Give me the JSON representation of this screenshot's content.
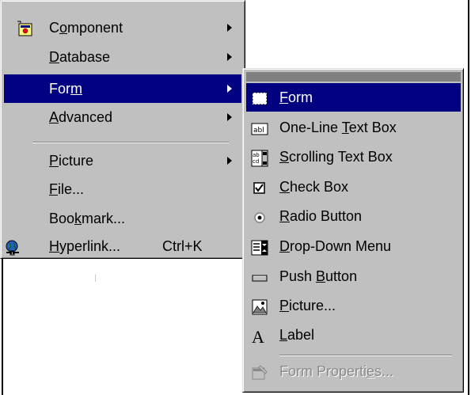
{
  "main_menu": {
    "items": [
      {
        "name": "component",
        "label": "Component",
        "mnemonic_index": 1,
        "has_submenu": true,
        "icon": "component-icon"
      },
      {
        "name": "database",
        "label": "Database",
        "mnemonic_index": 0,
        "has_submenu": true
      },
      {
        "name": "form",
        "label": "Form",
        "mnemonic_index": 3,
        "has_submenu": true,
        "highlighted": true
      },
      {
        "name": "advanced",
        "label": "Advanced",
        "mnemonic_index": 0,
        "has_submenu": true
      },
      {
        "name": "picture",
        "label": "Picture",
        "mnemonic_index": 0,
        "has_submenu": true
      },
      {
        "name": "file",
        "label": "File...",
        "mnemonic_index": 0
      },
      {
        "name": "bookmark",
        "label": "Bookmark...",
        "mnemonic_index": 3
      },
      {
        "name": "hyperlink",
        "label": "Hyperlink...",
        "mnemonic_index": 0,
        "shortcut": "Ctrl+K",
        "icon": "hyperlink-globe-icon"
      }
    ]
  },
  "form_submenu": {
    "items": [
      {
        "name": "form",
        "label": "Form",
        "mnemonic_index": 0,
        "icon": "form-dotted-box-icon",
        "highlighted": true
      },
      {
        "name": "one-line-text-box",
        "label": "One-Line Text Box",
        "mnemonic_index": 9,
        "icon": "text-box-icon"
      },
      {
        "name": "scrolling-text-box",
        "label": "Scrolling Text Box",
        "mnemonic_index": 0,
        "icon": "scrolling-text-box-icon"
      },
      {
        "name": "check-box",
        "label": "Check Box",
        "mnemonic_index": 0,
        "icon": "checkbox-icon"
      },
      {
        "name": "radio-button",
        "label": "Radio Button",
        "mnemonic_index": 0,
        "icon": "radio-button-icon"
      },
      {
        "name": "drop-down-menu",
        "label": "Drop-Down Menu",
        "mnemonic_index": 0,
        "icon": "drop-down-menu-icon"
      },
      {
        "name": "push-button",
        "label": "Push Button",
        "mnemonic_index": 5,
        "icon": "push-button-icon"
      },
      {
        "name": "picture",
        "label": "Picture...",
        "mnemonic_index": 0,
        "icon": "picture-icon"
      },
      {
        "name": "label",
        "label": "Label",
        "mnemonic_index": 0,
        "icon": "label-a-icon"
      },
      {
        "name": "form-properties",
        "label": "Form Properties...",
        "mnemonic_index": 13,
        "icon": "form-properties-icon",
        "disabled": true
      }
    ]
  },
  "colors": {
    "menu_bg": "#c0c0c0",
    "highlight": "#000080",
    "highlight_text": "#ffffff",
    "disabled_text": "#8a8a8a"
  }
}
